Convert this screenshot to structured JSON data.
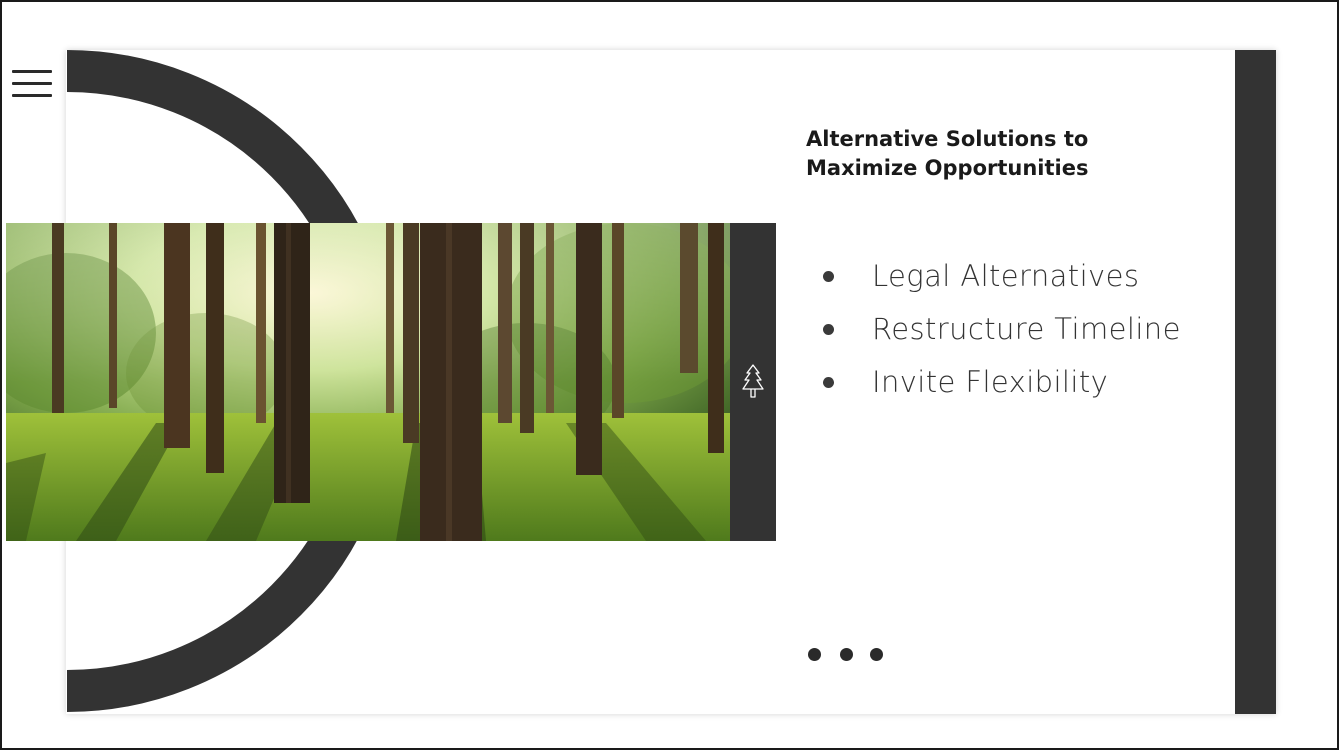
{
  "slide": {
    "heading_line1": "Alternative Solutions to",
    "heading_line2": "Maximize Opportunities",
    "bullets": [
      "Legal Alternatives",
      "Restructure Timeline",
      "Invite Flexibility"
    ]
  },
  "icons": {
    "menu": "hamburger-menu-icon",
    "tree": "tree-icon",
    "more": "ellipsis-icon"
  },
  "colors": {
    "dark_accent": "#333333",
    "text": "#1a1a1a",
    "background": "#ffffff"
  }
}
